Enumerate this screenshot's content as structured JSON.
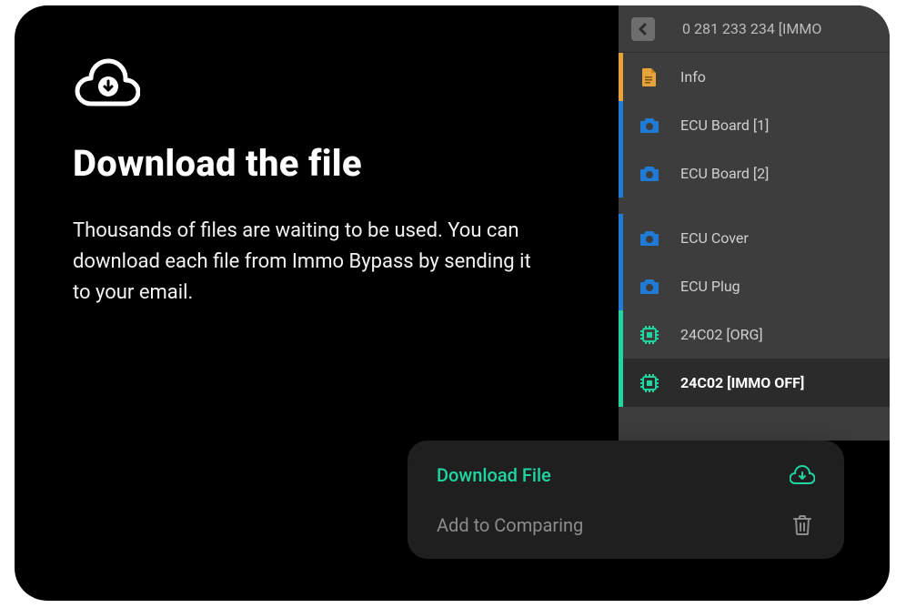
{
  "left": {
    "title": "Download the file",
    "desc": "Thousands of files are waiting to be used. You can download each file from Immo Bypass by sending it to your email."
  },
  "panel": {
    "title": "0 281 233 234 [IMMO",
    "items": [
      {
        "label": "Info",
        "icon": "doc",
        "stripe": "orange"
      },
      {
        "label": "ECU Board [1]",
        "icon": "camera",
        "stripe": "blue"
      },
      {
        "label": "ECU Board [2]",
        "icon": "camera",
        "stripe": "blue"
      },
      {
        "label": "ECU Cover",
        "icon": "camera",
        "stripe": "blue"
      },
      {
        "label": "ECU Plug",
        "icon": "camera",
        "stripe": "blue"
      },
      {
        "label": "24C02 [ORG]",
        "icon": "chip",
        "stripe": "green"
      },
      {
        "label": "24C02 [IMMO OFF]",
        "icon": "chip",
        "stripe": "green",
        "selected": true
      }
    ]
  },
  "sheet": {
    "download": "Download File",
    "compare": "Add to Comparing"
  }
}
